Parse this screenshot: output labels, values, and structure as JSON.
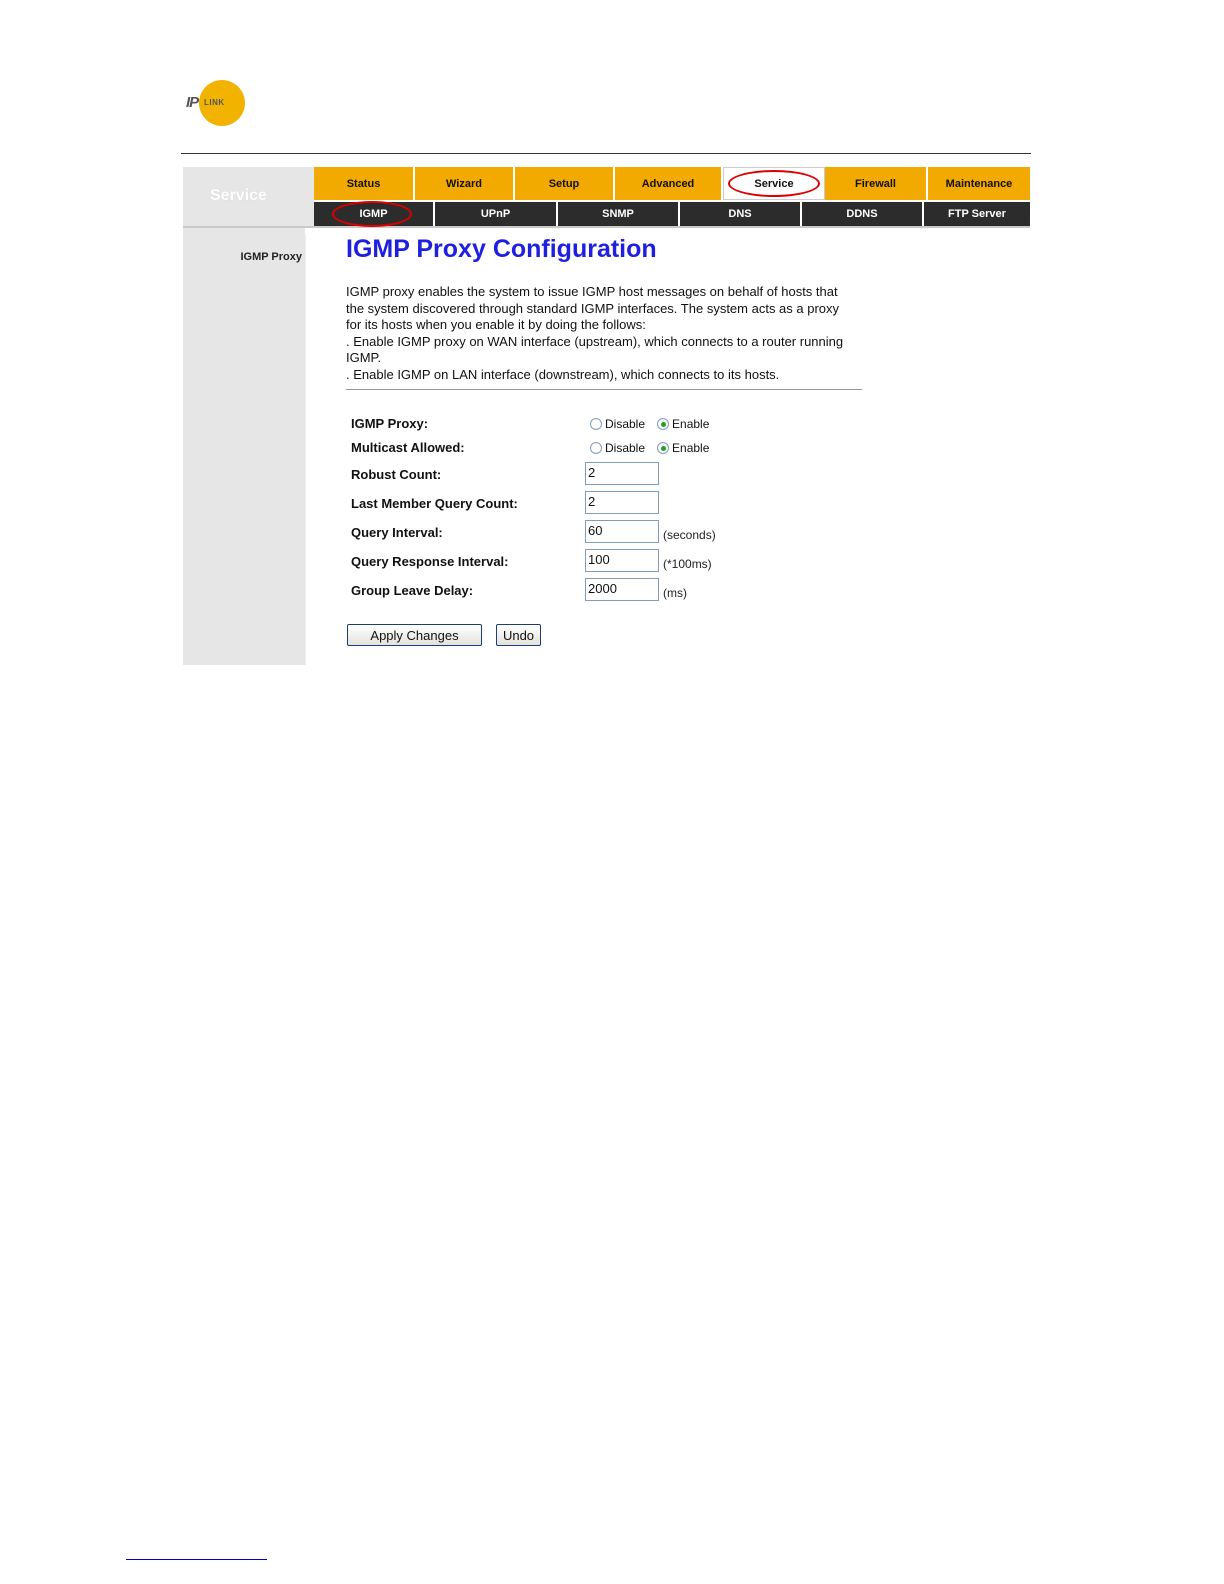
{
  "logo": {
    "ip": "IP",
    "link": "LINK"
  },
  "side": {
    "heading": "Service",
    "item": "IGMP Proxy"
  },
  "tabs": [
    "Status",
    "Wizard",
    "Setup",
    "Advanced",
    "Service",
    "Firewall",
    "Maintenance"
  ],
  "active_tab": "Service",
  "subtabs": [
    "IGMP",
    "UPnP",
    "SNMP",
    "DNS",
    "DDNS",
    "FTP Server"
  ],
  "active_subtab": "IGMP",
  "page": {
    "title": "IGMP Proxy Configuration",
    "desc": [
      "IGMP proxy enables the system to issue IGMP host messages on behalf of hosts that",
      "the system discovered through standard IGMP interfaces. The system acts as a proxy",
      "for its hosts when you enable it by doing the follows:",
      ". Enable IGMP proxy on WAN interface (upstream), which connects to a router running",
      "IGMP.",
      ". Enable IGMP on LAN interface (downstream), which connects to its hosts."
    ]
  },
  "form": {
    "igmp_proxy": {
      "label": "IGMP Proxy:",
      "disable": "Disable",
      "enable": "Enable",
      "selected": "Enable"
    },
    "multicast": {
      "label": "Multicast Allowed:",
      "disable": "Disable",
      "enable": "Enable",
      "selected": "Enable"
    },
    "robust": {
      "label": "Robust Count:",
      "value": "2"
    },
    "last_member": {
      "label": "Last Member Query Count:",
      "value": "2"
    },
    "query_interval": {
      "label": "Query Interval:",
      "value": "60",
      "unit": "(seconds)"
    },
    "query_response": {
      "label": "Query Response Interval:",
      "value": "100",
      "unit": "(*100ms)"
    },
    "group_leave": {
      "label": "Group Leave Delay:",
      "value": "2000",
      "unit": "(ms)"
    }
  },
  "buttons": {
    "apply": "Apply Changes",
    "undo": "Undo"
  },
  "colors": {
    "tab_bg": "#f2a900",
    "subtab_bg": "#2c2c2c",
    "title": "#1f1fe0",
    "highlight_ring": "#dd0000",
    "radio_dot": "#21a121"
  }
}
